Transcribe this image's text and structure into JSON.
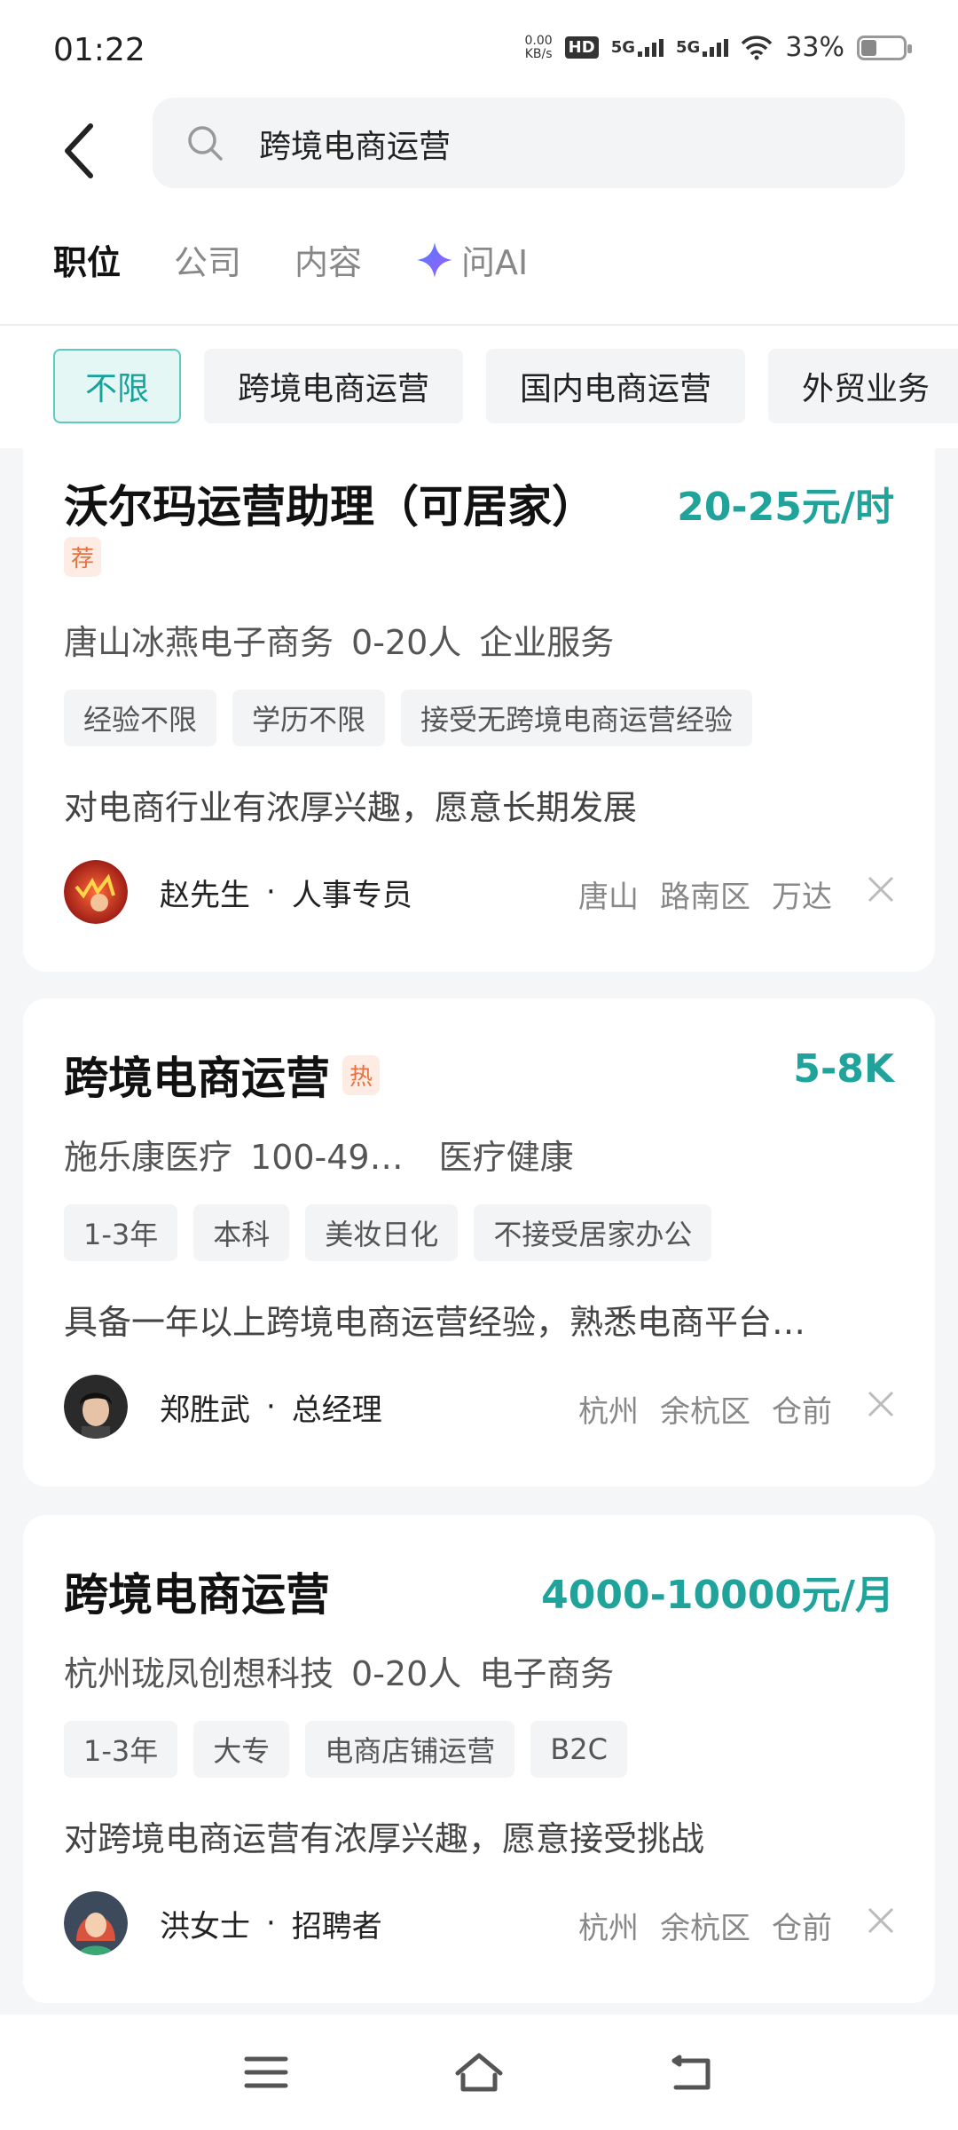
{
  "status": {
    "time": "01:22",
    "net_speed_top": "0.00",
    "net_speed_bottom": "KB/s",
    "hd": "HD",
    "sig1": "5G",
    "sig2": "5G",
    "battery": "33%"
  },
  "search": {
    "query": "跨境电商运营"
  },
  "tabs": [
    {
      "label": "职位",
      "active": true
    },
    {
      "label": "公司",
      "active": false
    },
    {
      "label": "内容",
      "active": false
    },
    {
      "label": "问AI",
      "active": false
    }
  ],
  "filters": [
    {
      "label": "不限",
      "active": true
    },
    {
      "label": "跨境电商运营",
      "active": false
    },
    {
      "label": "国内电商运营",
      "active": false
    },
    {
      "label": "外贸业务",
      "active": false
    }
  ],
  "jobs": [
    {
      "title": "沃尔玛运营助理（可居家）",
      "badge": "荐",
      "salary": "20-25元/时",
      "company": "唐山冰燕电子商务",
      "size": "0-20人",
      "industry": "企业服务",
      "tags": [
        "经验不限",
        "学历不限",
        "接受无跨境电商运营经验"
      ],
      "desc": "对电商行业有浓厚兴趣，愿意长期发展",
      "recruiter_name": "赵先生",
      "recruiter_dot": "·",
      "recruiter_role": "人事专员",
      "loc": [
        "唐山",
        "路南区",
        "万达"
      ]
    },
    {
      "title": "跨境电商运营",
      "badge": "热",
      "salary": "5-8K",
      "company": "施乐康医疗",
      "size": "100-49…",
      "industry": "医疗健康",
      "tags": [
        "1-3年",
        "本科",
        "美妆日化",
        "不接受居家办公"
      ],
      "desc": "具备一年以上跨境电商运营经验，熟悉电商平台…",
      "recruiter_name": "郑胜武",
      "recruiter_dot": "·",
      "recruiter_role": "总经理",
      "loc": [
        "杭州",
        "余杭区",
        "仓前"
      ]
    },
    {
      "title": "跨境电商运营",
      "badge": "",
      "salary": "4000-10000元/月",
      "company": "杭州珑凤创想科技",
      "size": "0-20人",
      "industry": "电子商务",
      "tags": [
        "1-3年",
        "大专",
        "电商店铺运营",
        "B2C"
      ],
      "desc": "对跨境电商运营有浓厚兴趣，愿意接受挑战",
      "recruiter_name": "洪女士",
      "recruiter_dot": "·",
      "recruiter_role": "招聘者",
      "loc": [
        "杭州",
        "余杭区",
        "仓前"
      ]
    }
  ],
  "colors": {
    "accent": "#1fa39a",
    "hot": "#e8713f"
  },
  "icons": {
    "back": "chevron-left-icon",
    "search": "search-icon",
    "ai": "sparkle-icon",
    "close": "close-icon",
    "nav_menu": "menu-icon",
    "nav_home": "home-icon",
    "nav_back": "back-icon"
  }
}
